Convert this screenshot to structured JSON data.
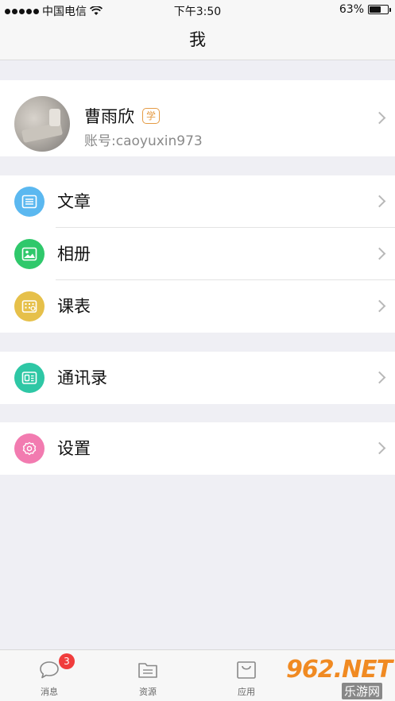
{
  "status_bar": {
    "carrier": "中国电信",
    "time": "下午3:50",
    "battery_text": "63%",
    "battery_level": 0.63
  },
  "nav": {
    "title": "我"
  },
  "profile": {
    "name": "曹雨欣",
    "badge": "学",
    "account": "账号:caoyuxin973"
  },
  "menu": {
    "group1": [
      {
        "label": "文章",
        "icon": "article-icon",
        "color": "#5bb8f0"
      },
      {
        "label": "相册",
        "icon": "album-icon",
        "color": "#2fc86b"
      },
      {
        "label": "课表",
        "icon": "schedule-icon",
        "color": "#e6c04a"
      }
    ],
    "group2": [
      {
        "label": "通讯录",
        "icon": "contacts-icon",
        "color": "#2ec7a5"
      }
    ],
    "group3": [
      {
        "label": "设置",
        "icon": "settings-icon",
        "color": "#f27bb0"
      }
    ]
  },
  "tab_bar": {
    "tabs": [
      {
        "label": "消息",
        "icon": "message-icon",
        "badge": "3"
      },
      {
        "label": "资源",
        "icon": "folder-icon"
      },
      {
        "label": "应用",
        "icon": "bag-icon"
      },
      {
        "label": "",
        "icon": ""
      }
    ]
  },
  "watermark": {
    "main": "962.NET",
    "sub": "乐游网"
  }
}
